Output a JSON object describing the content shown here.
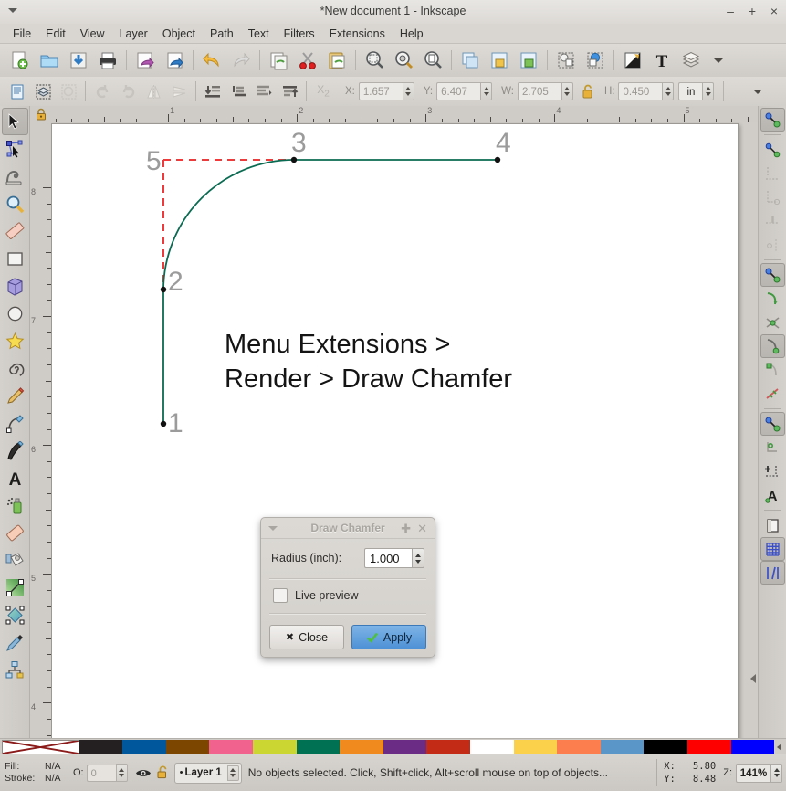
{
  "window": {
    "title": "*New document 1 - Inkscape",
    "minimize": "–",
    "maximize": "+",
    "close": "×"
  },
  "menubar": {
    "items": [
      {
        "label": "File"
      },
      {
        "label": "Edit"
      },
      {
        "label": "View"
      },
      {
        "label": "Layer"
      },
      {
        "label": "Object"
      },
      {
        "label": "Path"
      },
      {
        "label": "Text"
      },
      {
        "label": "Filters"
      },
      {
        "label": "Extensions"
      },
      {
        "label": "Help"
      }
    ]
  },
  "command_bar": {
    "buttons": [
      {
        "name": "new-document-icon"
      },
      {
        "name": "open-document-icon"
      },
      {
        "name": "save-document-icon"
      },
      {
        "name": "print-document-icon"
      },
      {
        "name": "import-icon"
      },
      {
        "name": "export-icon"
      },
      {
        "name": "undo-icon"
      },
      {
        "name": "redo-icon"
      },
      {
        "name": "copy-icon"
      },
      {
        "name": "cut-icon"
      },
      {
        "name": "paste-icon"
      },
      {
        "name": "zoom-selection-icon"
      },
      {
        "name": "zoom-drawing-icon"
      },
      {
        "name": "zoom-page-icon"
      },
      {
        "name": "duplicate-icon"
      },
      {
        "name": "group-icon"
      },
      {
        "name": "ungroup-icon"
      },
      {
        "name": "raise-to-top-icon"
      },
      {
        "name": "lower-to-bottom-icon"
      },
      {
        "name": "fill-stroke-dialog-icon"
      },
      {
        "name": "text-dialog-icon"
      },
      {
        "name": "layers-dialog-icon"
      },
      {
        "name": "overflow-chevron-icon"
      }
    ]
  },
  "tool_options_bar": {
    "buttons": [
      {
        "name": "select-all-icon"
      },
      {
        "name": "select-all-in-layers-icon"
      },
      {
        "name": "deselect-icon"
      },
      {
        "name": "rotate-ccw-icon"
      },
      {
        "name": "rotate-cw-icon"
      },
      {
        "name": "flip-horizontal-icon"
      },
      {
        "name": "flip-vertical-icon"
      },
      {
        "name": "lower-to-bottom-icon"
      },
      {
        "name": "lower-icon"
      },
      {
        "name": "raise-icon"
      },
      {
        "name": "raise-to-top-icon"
      },
      {
        "name": "affect-transform-icon"
      }
    ],
    "fields": [
      {
        "label": "X:",
        "value": "1.657"
      },
      {
        "label": "Y:",
        "value": "6.407"
      },
      {
        "label": "W:",
        "value": "2.705"
      },
      {
        "label": "H:",
        "value": "0.450"
      }
    ],
    "lock_icon": "unlocked-padlock-icon",
    "unit": "in",
    "overflow": "overflow-chevron-icon"
  },
  "toolbox": {
    "tools": [
      {
        "name": "selector-tool",
        "label": "Selector",
        "selected": true
      },
      {
        "name": "node-tool",
        "label": "Node editor",
        "selected": false
      },
      {
        "name": "tweak-tool",
        "label": "Tweak",
        "selected": false
      },
      {
        "name": "zoom-tool",
        "label": "Zoom",
        "selected": false
      },
      {
        "name": "measure-tool",
        "label": "Measure",
        "selected": false
      },
      {
        "name": "rectangle-tool",
        "label": "Rectangle",
        "selected": false
      },
      {
        "name": "box3d-tool",
        "label": "3D Box",
        "selected": false
      },
      {
        "name": "ellipse-tool",
        "label": "Ellipse",
        "selected": false
      },
      {
        "name": "star-tool",
        "label": "Star",
        "selected": false
      },
      {
        "name": "spiral-tool",
        "label": "Spiral",
        "selected": false
      },
      {
        "name": "pencil-tool",
        "label": "Pencil",
        "selected": false
      },
      {
        "name": "bezier-tool",
        "label": "Bezier/Pen",
        "selected": false
      },
      {
        "name": "calligraphy-tool",
        "label": "Calligraphy",
        "selected": false
      },
      {
        "name": "text-tool",
        "label": "Text",
        "selected": false
      },
      {
        "name": "spray-tool",
        "label": "Spray",
        "selected": false
      },
      {
        "name": "eraser-tool",
        "label": "Eraser",
        "selected": false
      },
      {
        "name": "paint-bucket-tool",
        "label": "Paint bucket",
        "selected": false
      },
      {
        "name": "gradient-tool",
        "label": "Gradient",
        "selected": false
      },
      {
        "name": "mesh-tool",
        "label": "Mesh gradient",
        "selected": false
      },
      {
        "name": "dropper-tool",
        "label": "Dropper",
        "selected": false
      },
      {
        "name": "connector-tool",
        "label": "Connector",
        "selected": false
      }
    ]
  },
  "snapbar": {
    "buttons": [
      {
        "name": "enable-snapping-toggle",
        "on": true
      },
      {
        "name": "snap-bounding-boxes-toggle",
        "on": false
      },
      {
        "name": "snap-bbox-edges-toggle",
        "on": false
      },
      {
        "name": "snap-bbox-corners-toggle",
        "on": false
      },
      {
        "name": "snap-bbox-edge-midpoints-toggle",
        "on": false
      },
      {
        "name": "snap-bbox-centers-toggle",
        "on": false
      },
      {
        "name": "snap-nodes-paths-toggle",
        "on": true
      },
      {
        "name": "snap-to-paths-toggle",
        "on": false
      },
      {
        "name": "snap-path-intersections-toggle",
        "on": false
      },
      {
        "name": "snap-to-cusp-nodes-toggle",
        "on": true
      },
      {
        "name": "snap-smooth-nodes-toggle",
        "on": false
      },
      {
        "name": "snap-line-midpoints-toggle",
        "on": false
      },
      {
        "name": "snap-others-toggle",
        "on": true
      },
      {
        "name": "snap-object-centers-toggle",
        "on": false
      },
      {
        "name": "snap-rotation-centers-toggle",
        "on": false
      },
      {
        "name": "snap-text-baseline-toggle",
        "on": false
      },
      {
        "name": "snap-page-border-toggle",
        "on": false
      },
      {
        "name": "snap-grids-toggle",
        "on": true
      },
      {
        "name": "snap-guides-toggle",
        "on": true
      }
    ]
  },
  "rulers": {
    "unit": "in",
    "horizontal_labels": [
      "1",
      "2",
      "3",
      "4",
      "5"
    ],
    "vertical_labels": [
      "8",
      "7",
      "6",
      "5",
      "4"
    ]
  },
  "canvas": {
    "annotation_line_1": "Menu Extensions >",
    "annotation_line_2": "Render > Draw Chamfer",
    "point_labels": [
      "1",
      "2",
      "3",
      "4",
      "5"
    ],
    "path_color": "#0b6b52",
    "construction_color": "#ee3a3a",
    "label_color": "#9b9b9b",
    "node_color": "#111111"
  },
  "dialog": {
    "title": "Draw Chamfer",
    "collapse_icon": "triangle-down-icon",
    "float_icon": "float-window-icon",
    "close_icon": "close-icon",
    "radius_label": "Radius (inch):",
    "radius_value": "1.000",
    "live_preview_label": "Live preview",
    "live_preview_checked": false,
    "close_button": "Close",
    "apply_button": "Apply"
  },
  "palette": {
    "swatches": [
      {
        "name": "none",
        "color": "#ffffff"
      },
      {
        "name": "black-90",
        "color": "#241f20"
      },
      {
        "name": "blue",
        "color": "#00579c"
      },
      {
        "name": "brown",
        "color": "#7c4600"
      },
      {
        "name": "pink",
        "color": "#f2628f"
      },
      {
        "name": "lime",
        "color": "#ccd633"
      },
      {
        "name": "teal-green",
        "color": "#007253"
      },
      {
        "name": "orange",
        "color": "#f0891e"
      },
      {
        "name": "purple",
        "color": "#6b2c86"
      },
      {
        "name": "brick-red",
        "color": "#c32b17"
      },
      {
        "name": "white",
        "color": "#ffffff"
      },
      {
        "name": "gold",
        "color": "#fbd14b"
      },
      {
        "name": "salmon",
        "color": "#fc7e4e"
      },
      {
        "name": "steel-blue",
        "color": "#5b96c8"
      },
      {
        "name": "black",
        "color": "#000000"
      },
      {
        "name": "red",
        "color": "#ff0000"
      },
      {
        "name": "pure-blue",
        "color": "#0000ff"
      }
    ],
    "scroll_icon": "palette-scroll-arrow-icon"
  },
  "statusbar": {
    "fill_label": "Fill:",
    "fill_value": "N/A",
    "stroke_label": "Stroke:",
    "stroke_value": "N/A",
    "opacity_label": "O:",
    "opacity_value": "0",
    "visibility_icon": "eye-icon",
    "lock_icon": "unlocked-padlock-icon",
    "layer_name": "Layer 1",
    "message": "No objects selected. Click, Shift+click, Alt+scroll mouse on top of objects...",
    "x_label": "X:",
    "x_value": "5.80",
    "y_label": "Y:",
    "y_value": "8.48",
    "zoom_label": "Z:",
    "zoom_value": "141%"
  }
}
